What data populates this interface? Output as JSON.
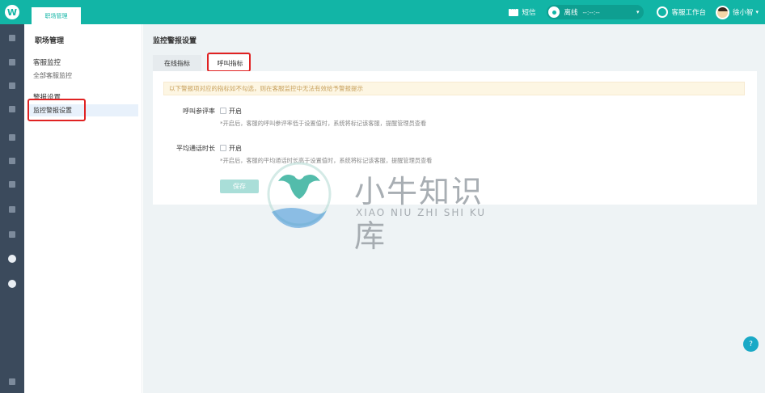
{
  "topbar": {
    "logo_glyph": "W",
    "module_tab": "职场管理",
    "sms_label": "短信",
    "status_label": "离线",
    "status_time": "--:--:--",
    "workspace_label": "客服工作台",
    "user_name": "徐小智",
    "caret": "▾"
  },
  "rail": {
    "icons": [
      "home-icon",
      "grid-icon",
      "doc-icon",
      "chat-icon",
      "user-icon",
      "chart-icon",
      "search-icon",
      "gear-icon",
      "report-icon",
      "staff-icon",
      "account-icon",
      "bell-icon"
    ]
  },
  "sidebar": {
    "title": "职场管理",
    "group1": "客服监控",
    "group1_link": "全部客服监控",
    "group2": "警报设置",
    "group2_link": "监控警报设置"
  },
  "main": {
    "page_title": "监控警报设置",
    "tabs": [
      {
        "label": "在线指标"
      },
      {
        "label": "呼叫指标"
      }
    ],
    "notice": "以下警报项对应的指标如不勾选，则在客服监控中无法有效给予警报提示",
    "rows": [
      {
        "label": "呼叫参评率",
        "checkbox_label": "开启",
        "hint": "*开启后，客服的呼叫参评率低于设置值时，系统将标记该客服，提醒管理员查看"
      },
      {
        "label": "平均通话时长",
        "checkbox_label": "开启",
        "hint": "*开启后，客服的平均通话时长高于设置值时，系统将标记该客服，提醒管理员查看"
      }
    ],
    "save_label": "保存"
  },
  "watermark": {
    "cn": "小牛知识库",
    "en": "XIAO NIU ZHI SHI KU"
  },
  "help_glyph": "?",
  "colors": {
    "brand": "#12b5a6",
    "rail": "#3b4a5c",
    "highlight": "#e02222"
  }
}
